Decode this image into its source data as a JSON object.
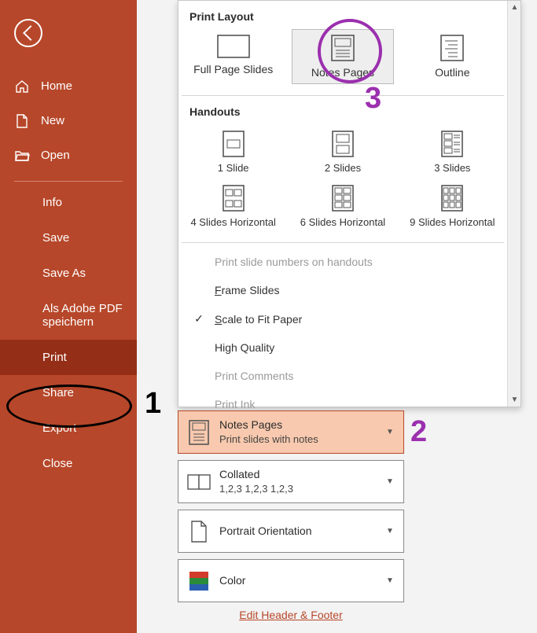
{
  "sidebar": {
    "nav": [
      {
        "label": "Home"
      },
      {
        "label": "New"
      },
      {
        "label": "Open"
      }
    ],
    "sub": [
      {
        "label": "Info"
      },
      {
        "label": "Save"
      },
      {
        "label": "Save As"
      },
      {
        "label": "Als Adobe PDF speichern"
      },
      {
        "label": "Print"
      },
      {
        "label": "Share"
      },
      {
        "label": "Export"
      },
      {
        "label": "Close"
      }
    ]
  },
  "popup": {
    "section1_header": "Print Layout",
    "layout": [
      {
        "label": "Full Page Slides"
      },
      {
        "label": "Notes Pages"
      },
      {
        "label": "Outline"
      }
    ],
    "section2_header": "Handouts",
    "handouts": [
      {
        "label": "1 Slide"
      },
      {
        "label": "2 Slides"
      },
      {
        "label": "3 Slides"
      },
      {
        "label": "4 Slides Horizontal"
      },
      {
        "label": "6 Slides Horizontal"
      },
      {
        "label": "9 Slides Horizontal"
      }
    ],
    "options": [
      {
        "label": "Print slide numbers on handouts",
        "disabled": true,
        "checked": false
      },
      {
        "label": "Frame Slides",
        "disabled": false,
        "checked": false,
        "hotkey": "F"
      },
      {
        "label": "Scale to Fit Paper",
        "disabled": false,
        "checked": true,
        "hotkey": "S"
      },
      {
        "label": "High Quality",
        "disabled": false,
        "checked": false
      },
      {
        "label": "Print Comments",
        "disabled": true,
        "checked": false
      },
      {
        "label": "Print Ink",
        "disabled": true,
        "checked": false
      }
    ]
  },
  "settings": {
    "row1": {
      "title": "Notes Pages",
      "sub": "Print slides with notes"
    },
    "row2": {
      "title": "Collated",
      "sub": "1,2,3    1,2,3    1,2,3"
    },
    "row3": {
      "title": "Portrait Orientation"
    },
    "row4": {
      "title": "Color"
    },
    "link": "Edit Header & Footer"
  },
  "annotations": {
    "one": "1",
    "two": "2",
    "three": "3"
  }
}
